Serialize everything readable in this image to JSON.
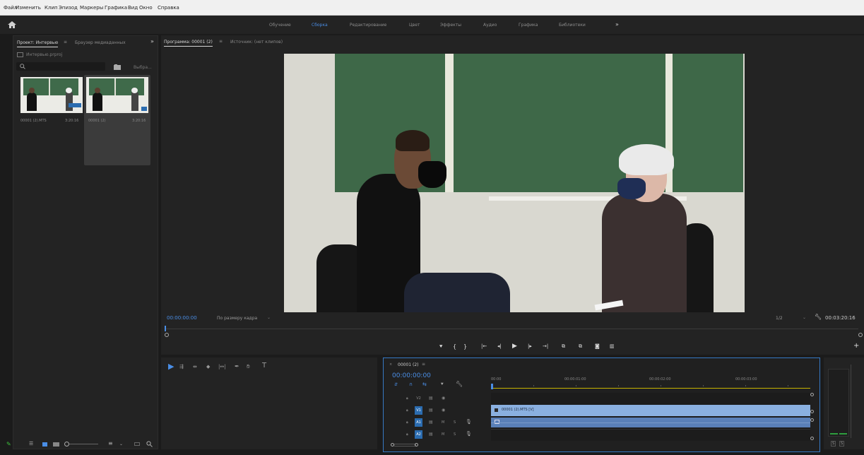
{
  "menu": {
    "items": [
      "Файл",
      "Изменить",
      "Клип",
      "Эпизод",
      "Маркеры",
      "Графика",
      "Вид",
      "Окно",
      "Справка"
    ]
  },
  "workspaces": {
    "items": [
      "Обучение",
      "Сборка",
      "Редактирование",
      "Цвет",
      "Эффекты",
      "Аудио",
      "Графика",
      "Библиотеки"
    ],
    "active": "Сборка",
    "more": "»"
  },
  "project": {
    "tabs": [
      "Проект: Интервью",
      "Браузер медиаданных"
    ],
    "more": "»",
    "file": "Интервью.prproj",
    "search_placeholder": "",
    "find_label": "Выбра...",
    "clips": [
      {
        "name": "00001 (2).MTS",
        "duration": "3:20:16"
      },
      {
        "name": "00001 (2)",
        "duration": "3:20:16"
      }
    ]
  },
  "program": {
    "tab_label": "Программа: 00001 (2)",
    "source_label": "Источник: (нет клипов)",
    "timecode": "00:00:00:00",
    "fit_label": "По размеру кадра",
    "resolution": "1/2",
    "duration": "00:03:20:16"
  },
  "timeline": {
    "sequence_name": "00001 (2)",
    "timecode": "00:00:00:00",
    "ruler": [
      "00:00",
      "00:00:01:00",
      "00:00:02:00",
      "00:00:03:00"
    ],
    "tracks": [
      {
        "id": "V2",
        "type": "video",
        "m": "",
        "s": ""
      },
      {
        "id": "V1",
        "type": "video",
        "m": "",
        "s": ""
      },
      {
        "id": "A1",
        "type": "audio",
        "m": "M",
        "s": "S"
      },
      {
        "id": "A2",
        "type": "audio",
        "m": "M",
        "s": "S"
      }
    ],
    "clip_label": "00001 (2).MTS [V]"
  },
  "meters": {
    "s1": "S",
    "s2": "S"
  },
  "colors": {
    "accent": "#4a8ee6",
    "clip_video": "#8ab0e0",
    "clip_audio": "#5a80b8",
    "track_active": "#2b6cb0"
  }
}
